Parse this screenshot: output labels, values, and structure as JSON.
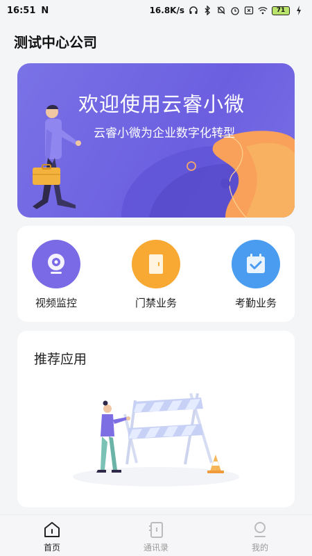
{
  "status_bar": {
    "time": "16:51",
    "net_speed": "16.8K/s",
    "battery": "71"
  },
  "header": {
    "company": "测试中心公司"
  },
  "banner": {
    "title": "欢迎使用云睿小微",
    "subtitle": "云睿小微为企业数字化转型"
  },
  "quick_actions": [
    {
      "label": "视频监控",
      "icon": "camera-icon",
      "color": "#7a6ae6"
    },
    {
      "label": "门禁业务",
      "icon": "door-icon",
      "color": "#f7a934"
    },
    {
      "label": "考勤业务",
      "icon": "calendar-check-icon",
      "color": "#4a9cf0"
    }
  ],
  "recommended": {
    "title": "推荐应用"
  },
  "tabs": [
    {
      "label": "首页",
      "icon": "home-icon",
      "active": true
    },
    {
      "label": "通讯录",
      "icon": "contacts-icon",
      "active": false
    },
    {
      "label": "我的",
      "icon": "user-icon",
      "active": false
    }
  ],
  "colors": {
    "banner": "#6b5fe0",
    "accent_orange": "#f7a934",
    "accent_blue": "#4a9cf0",
    "accent_purple": "#7a6ae6"
  }
}
